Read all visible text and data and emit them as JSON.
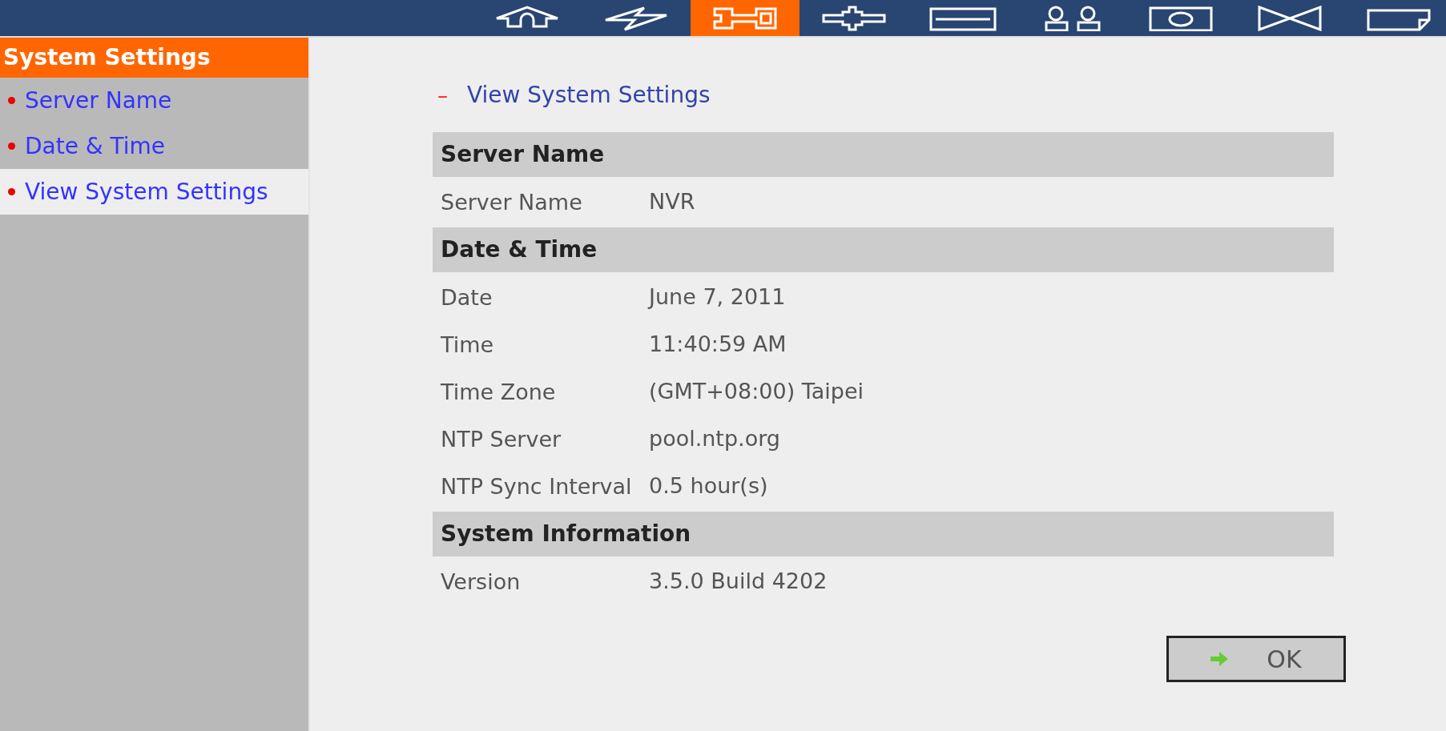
{
  "toolbar": {
    "tabs": [
      {
        "kind": "home",
        "selected": false
      },
      {
        "kind": "bolt",
        "selected": false
      },
      {
        "kind": "wrench",
        "selected": true
      },
      {
        "kind": "cross",
        "selected": false
      },
      {
        "kind": "bars",
        "selected": false
      },
      {
        "kind": "users",
        "selected": false
      },
      {
        "kind": "eye",
        "selected": false
      },
      {
        "kind": "bowtie",
        "selected": false
      },
      {
        "kind": "note",
        "selected": false
      }
    ]
  },
  "sidebar": {
    "title": "System Settings",
    "items": [
      {
        "label": "Server Name",
        "selected": false
      },
      {
        "label": "Date & Time",
        "selected": false
      },
      {
        "label": "View System Settings",
        "selected": true
      }
    ]
  },
  "content": {
    "heading_marker": "–",
    "heading": "View System Settings",
    "sections": [
      {
        "title": "Server Name",
        "rows": [
          {
            "label": "Server Name",
            "value": "NVR"
          }
        ]
      },
      {
        "title": "Date & Time",
        "rows": [
          {
            "label": "Date",
            "value": "June 7, 2011"
          },
          {
            "label": "Time",
            "value": "11:40:59 AM"
          },
          {
            "label": "Time Zone",
            "value": "(GMT+08:00) Taipei"
          },
          {
            "label": "NTP Server",
            "value": "pool.ntp.org"
          },
          {
            "label": "NTP Sync Interval",
            "value": "0.5 hour(s)"
          }
        ]
      },
      {
        "title": "System Information",
        "rows": [
          {
            "label": "Version",
            "value": "3.5.0 Build 4202"
          }
        ]
      }
    ],
    "ok_button": "OK"
  }
}
